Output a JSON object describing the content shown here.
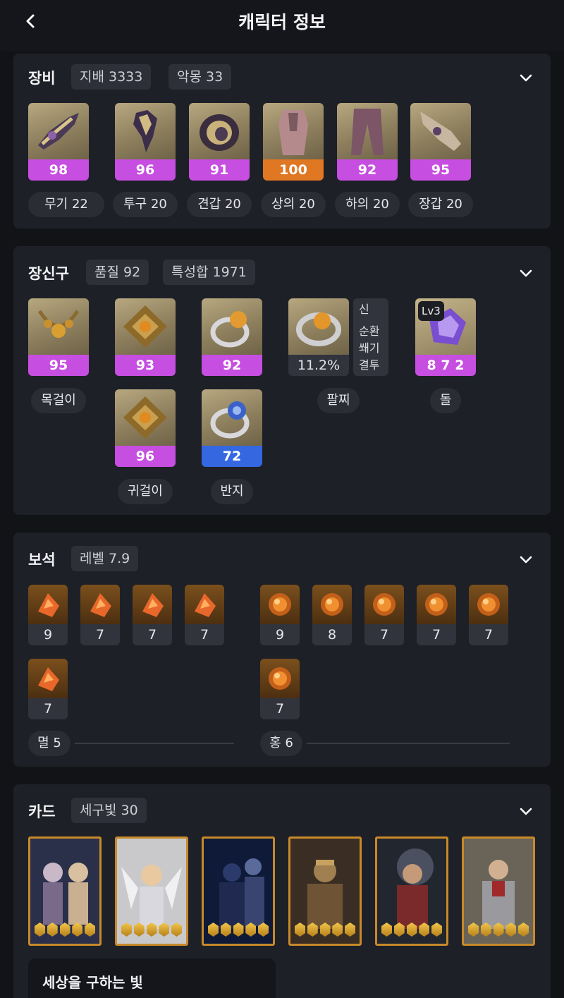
{
  "header": {
    "title": "캐릭터 정보",
    "back_icon": "chevron-left-icon"
  },
  "colors": {
    "legendary_quality": "#c64ee0",
    "max_quality": "#e07722",
    "low_quality": "#3467e0",
    "card_frame": "#c8892a"
  },
  "equipment": {
    "title": "장비",
    "badges": [
      "지배 3333",
      "악몽 33"
    ],
    "items": [
      {
        "quality": "98",
        "label": "무기 22",
        "icon": "weapon-icon"
      },
      {
        "quality": "96",
        "label": "투구 20",
        "icon": "helmet-icon"
      },
      {
        "quality": "91",
        "label": "견갑 20",
        "icon": "shoulder-icon"
      },
      {
        "quality": "100",
        "label": "상의 20",
        "icon": "chest-armor-icon"
      },
      {
        "quality": "92",
        "label": "하의 20",
        "icon": "pants-icon"
      },
      {
        "quality": "95",
        "label": "장갑 20",
        "icon": "gloves-icon"
      }
    ]
  },
  "accessories": {
    "title": "장신구",
    "badges": [
      "품질 92",
      "특성합 1971"
    ],
    "necklace": {
      "quality": "95",
      "label": "목걸이",
      "icon": "necklace-icon"
    },
    "earrings": [
      {
        "quality": "93",
        "icon": "earring-icon"
      },
      {
        "quality": "96",
        "icon": "earring-icon"
      }
    ],
    "earring_label": "귀걸이",
    "rings": [
      {
        "quality": "92",
        "icon": "ring-icon"
      },
      {
        "quality": "72",
        "icon": "ring-icon"
      }
    ],
    "ring_label": "반지",
    "bracelet": {
      "value": "11.2%",
      "label": "팔찌",
      "effects": [
        "신",
        "순환",
        "쐐기",
        "결투"
      ],
      "icon": "bracelet-icon"
    },
    "stone": {
      "level": "Lv3",
      "value": "8 7 2",
      "label": "돌",
      "icon": "ability-stone-icon"
    }
  },
  "gems": {
    "title": "보석",
    "badge": "레벨 7.9",
    "annihilation": {
      "values": [
        "9",
        "7",
        "7",
        "7",
        "7"
      ],
      "label": "멸 5"
    },
    "crimson": {
      "values": [
        "9",
        "8",
        "7",
        "7",
        "7",
        "7"
      ],
      "label": "홍 6"
    }
  },
  "cards": {
    "title": "카드",
    "badge": "세구빛 30",
    "items": [
      {
        "awaken": 5,
        "icon": "card-portrait-icon"
      },
      {
        "awaken": 5,
        "icon": "card-portrait-icon"
      },
      {
        "awaken": 5,
        "icon": "card-portrait-icon"
      },
      {
        "awaken": 5,
        "icon": "card-portrait-icon"
      },
      {
        "awaken": 5,
        "icon": "card-portrait-icon"
      },
      {
        "awaken": 5,
        "icon": "card-portrait-icon"
      }
    ],
    "set_name": "세상을 구하는 빛"
  }
}
